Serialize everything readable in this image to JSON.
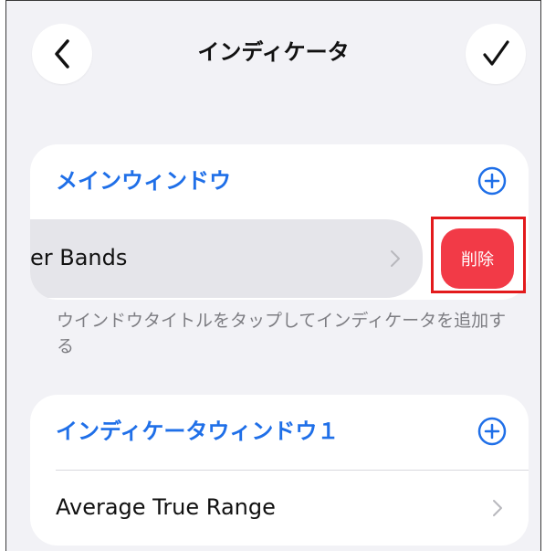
{
  "header": {
    "title": "インディケータ",
    "back_icon": "chevron-left-icon",
    "done_icon": "checkmark-icon"
  },
  "main_window": {
    "title": "メインウィンドウ",
    "add_icon": "plus-circle-icon",
    "row_label": "er Bands",
    "row_icon": "chevron-right-icon",
    "delete_label": "削除",
    "footnote": "ウインドウタイトルをタップしてインディケータを追加する"
  },
  "indicator_window": {
    "title": "インディケータウィンドウ１",
    "add_icon": "plus-circle-icon",
    "row_label": "Average True Range",
    "row_icon": "chevron-right-icon"
  },
  "colors": {
    "accent": "#1f6fe8",
    "delete": "#f23a47",
    "highlight": "#e31a1c",
    "background": "#f2f2f6"
  }
}
